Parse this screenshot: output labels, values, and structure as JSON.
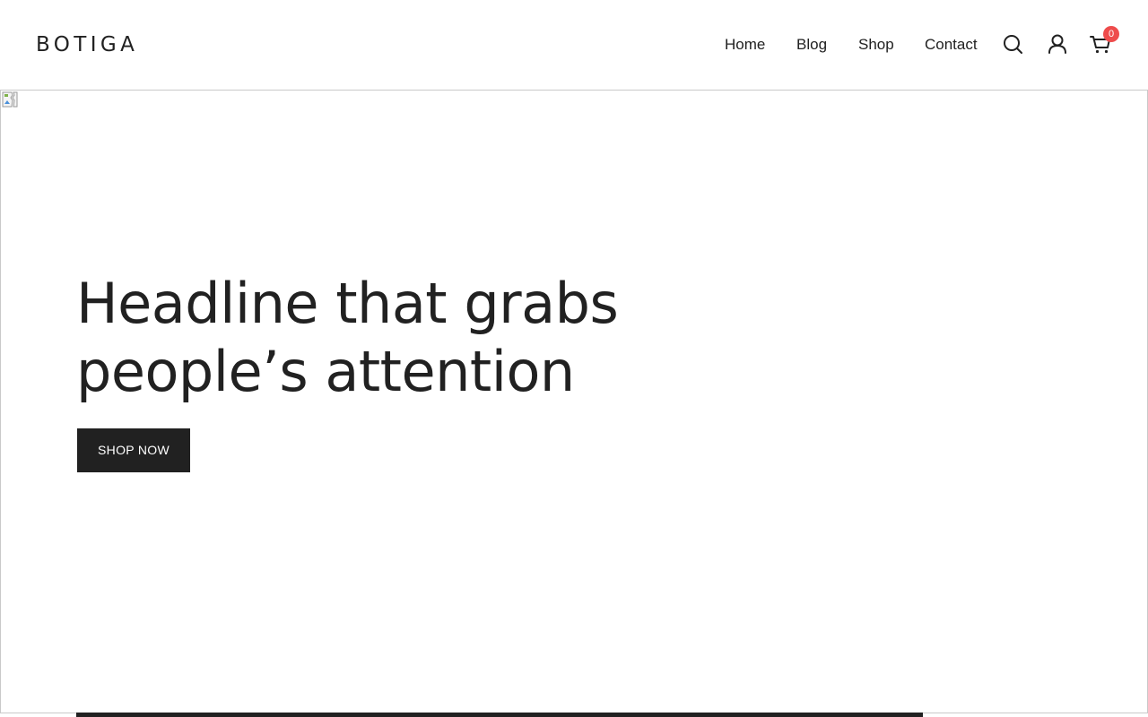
{
  "header": {
    "logo": "BOTIGA",
    "nav": [
      "Home",
      "Blog",
      "Shop",
      "Contact"
    ],
    "icons": [
      "search-icon",
      "account-icon",
      "cart-icon"
    ],
    "cart_count": "0",
    "badge_color": "#ee4c4c"
  },
  "hero": {
    "headline_line1": "Headline that grabs",
    "headline_line2": "people’s attention",
    "cta_label": "SHOP NOW",
    "image_state": "broken-image-icon"
  },
  "colors": {
    "text": "#212121",
    "button_bg": "#212121",
    "button_text": "#ffffff",
    "background": "#ffffff"
  }
}
